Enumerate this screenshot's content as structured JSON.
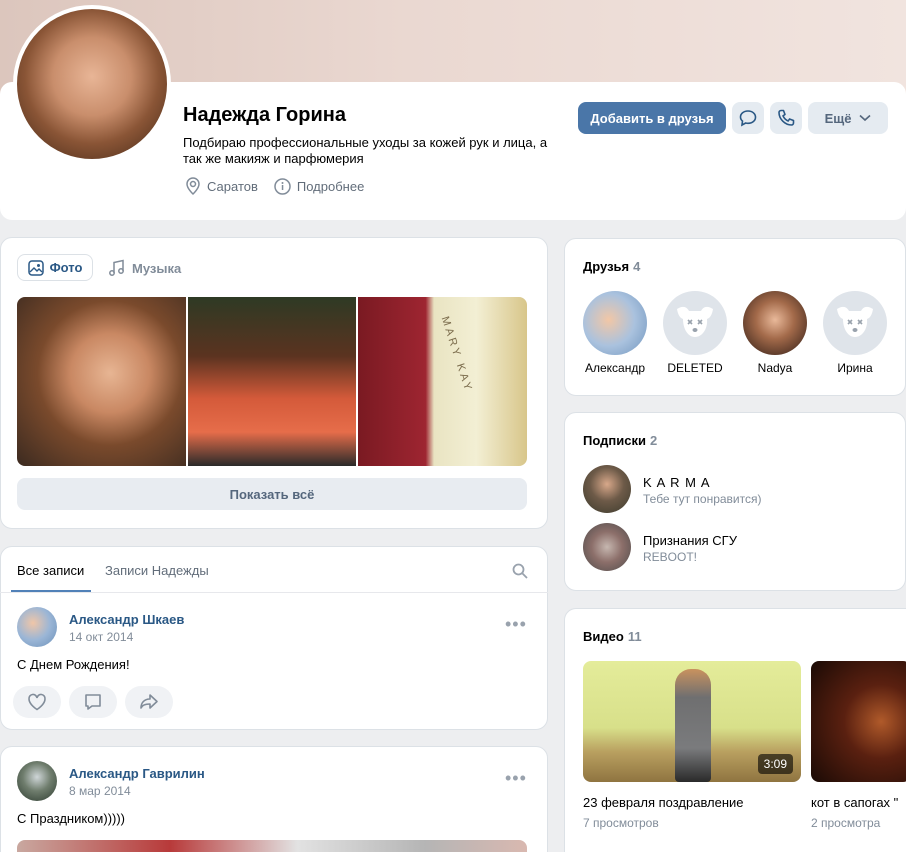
{
  "profile": {
    "name": "Надежда Горина",
    "status": "Подбираю профессиональные уходы за кожей рук и лица, а так же макияж и парфюмерия",
    "city": "Саратов",
    "details_label": "Подробнее",
    "add_friend_label": "Добавить в друзья",
    "more_label": "Ещё"
  },
  "media_tabs": {
    "photo_label": "Фото",
    "music_label": "Музыка",
    "show_all_label": "Показать всё"
  },
  "photos": [
    {
      "alt": "portrait"
    },
    {
      "alt": "party"
    },
    {
      "text": "MARY KAY"
    }
  ],
  "wall": {
    "tabs": [
      "Все записи",
      "Записи Надежды"
    ],
    "posts": [
      {
        "author": "Александр Шкаев",
        "date": "14 окт 2014",
        "text": "С Днем Рождения!"
      },
      {
        "author": "Александр Гаврилин",
        "date": "8 мар 2014",
        "text": "С Праздником)))))"
      }
    ]
  },
  "friends": {
    "title": "Друзья",
    "count": "4",
    "items": [
      {
        "name": "Александр"
      },
      {
        "name": "DELETED"
      },
      {
        "name": "Nadya"
      },
      {
        "name": "Ирина"
      }
    ]
  },
  "subscriptions": {
    "title": "Подписки",
    "count": "2",
    "items": [
      {
        "name": "K A R M A",
        "desc": "Тебе тут понравится)"
      },
      {
        "name": "Признания СГУ",
        "desc": "REBOOT!"
      }
    ]
  },
  "videos": {
    "title": "Видео",
    "count": "11",
    "items": [
      {
        "title": "23 февраля поздравление",
        "views": "7 просмотров",
        "duration": "3:09"
      },
      {
        "title": "кот в сапогах \"",
        "views": "2 просмотра"
      }
    ]
  },
  "colors": {
    "accent": "#4a76a8",
    "link": "#2a5885",
    "muted": "#818c99"
  }
}
